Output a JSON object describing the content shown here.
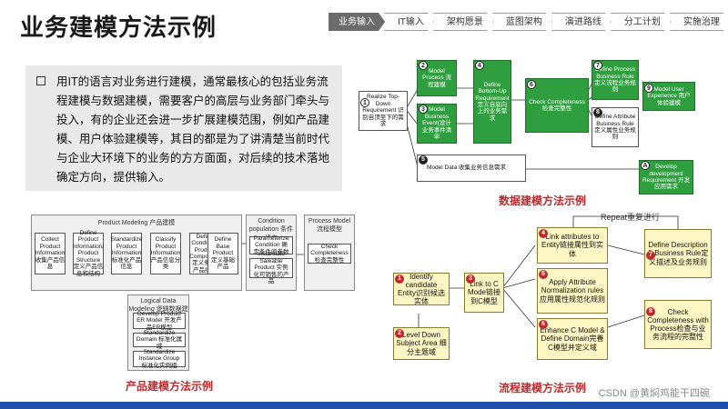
{
  "page": {
    "title": "业务建模方法示例"
  },
  "steps": [
    {
      "label": "业务输入",
      "active": true
    },
    {
      "label": "IT输入",
      "active": false
    },
    {
      "label": "架构愿景",
      "active": false
    },
    {
      "label": "蓝图架构",
      "active": false
    },
    {
      "label": "演进路线",
      "active": false
    },
    {
      "label": "分工计划",
      "active": false
    },
    {
      "label": "实施治理",
      "active": false
    }
  ],
  "intro": {
    "text": "用IT的语言对业务进行建模，通常最核心的包括业务流程建模与数据建模，需要客户的高层与业务部门牵头与投入，有的企业还会进一步扩展建模范围，例如产品建模、用户体验建模等，其目的都是为了讲清楚当前时代与企业大环境下的业务的方方面面，对后续的技术落地确定方向，提供输入。"
  },
  "data_model": {
    "caption": "数据建模方法示例",
    "realize": "Realize Top-Down Requirement 识别自顶至下的需求",
    "model_process": "Model Process 流程建模",
    "model_event": "Model Business Event(设计业务事件清单",
    "define_bottom": "Define Bottom-Up Requirement 定义自底向上的业务需求",
    "check": "Check Completeness 检查完整性",
    "define_rule": "Define Process Business Rule 定义流程业务规则",
    "define_attr": "Define Attribute Business Rule 定义属性业务规则",
    "model_ux": "Model User Experience 用户体验建模",
    "model_data": "Model Data 收集业务信息需求",
    "develop": "Develop development Requirement 开发应用需求"
  },
  "product_model": {
    "caption": "产品建模方法示例",
    "panel_title": "Product Modeling 产品建模",
    "collect": "Collect Product Information 收集产品信息",
    "define_info": "Define Product Information/ Product Structure 定义产品信息和结构",
    "standardize": "Standardize Product Information 标准化产品信息",
    "classify": "Classify Product Information 产品信息分类",
    "define_cond": "Define Condition/ Product Component 定义条件/产品组件",
    "define_base": "Define Base Product 定义基础产品",
    "cond_title": "Condition population 条件填充",
    "param": "Parameterize Condition 确定条件的参数",
    "instantiate": "Instantiate Saleable Product 实例化可销售的产品",
    "process_title": "Process Model 流程模型",
    "check": "Check Completeness 检查完整性",
    "logical_title": "Logical Data Modeling 逻辑数据建模",
    "develop_er": "Develop Product ER Model 开发产品ER模型",
    "std_domain": "Standardize Domain 标准化属域",
    "std_instance": "Standardize Instance Group 标准化实例组"
  },
  "process_model": {
    "caption": "流程建模方法示例",
    "repeat": "Repeat重复进行",
    "identify": "Identify candidate Entity识别候选实体",
    "level_down": "Level Down Subject Area 细分主题域",
    "link_c": "Link to C Mode链接到C模型",
    "link_attr": "Link attributes to Entity链接属性到实体",
    "apply_attr": "Apply Attribute Normalization rules 应用属性规范化规则",
    "enhance": "Enhance C Model & Define Domain完善C模型并定义域",
    "define_desc": "Define Description & Business Rule定义描述及业务规则",
    "check": "Check Completeness with Process检查与业务流程的完整性"
  },
  "watermark": "CSDN @黄焖鸡能干四碗"
}
